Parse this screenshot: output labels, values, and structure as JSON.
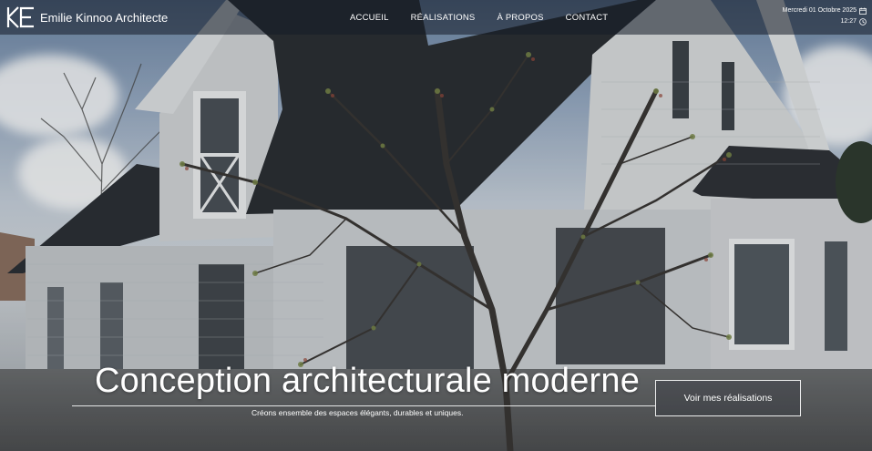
{
  "brand": {
    "name": "Emilie Kinnoo Architecte",
    "logo_text": "KE"
  },
  "nav": {
    "items": [
      {
        "label": "ACCUEIL"
      },
      {
        "label": "RÉALISATIONS"
      },
      {
        "label": "À PROPOS"
      },
      {
        "label": "CONTACT"
      }
    ]
  },
  "datetime": {
    "date": "Mercredi 01 Octobre 2025",
    "time": "12:27",
    "date_icon": "calendar-icon",
    "time_icon": "clock-icon"
  },
  "hero": {
    "title": "Conception architecturale moderne",
    "subtitle": "Créons ensemble des espaces élégants, durables et uniques.",
    "cta_label": "Voir mes réalisations",
    "background": "house-photo"
  },
  "colors": {
    "topbar": "#141c28",
    "text": "#ffffff",
    "roof": "#2b2e33",
    "siding": "#d9dbdd"
  }
}
